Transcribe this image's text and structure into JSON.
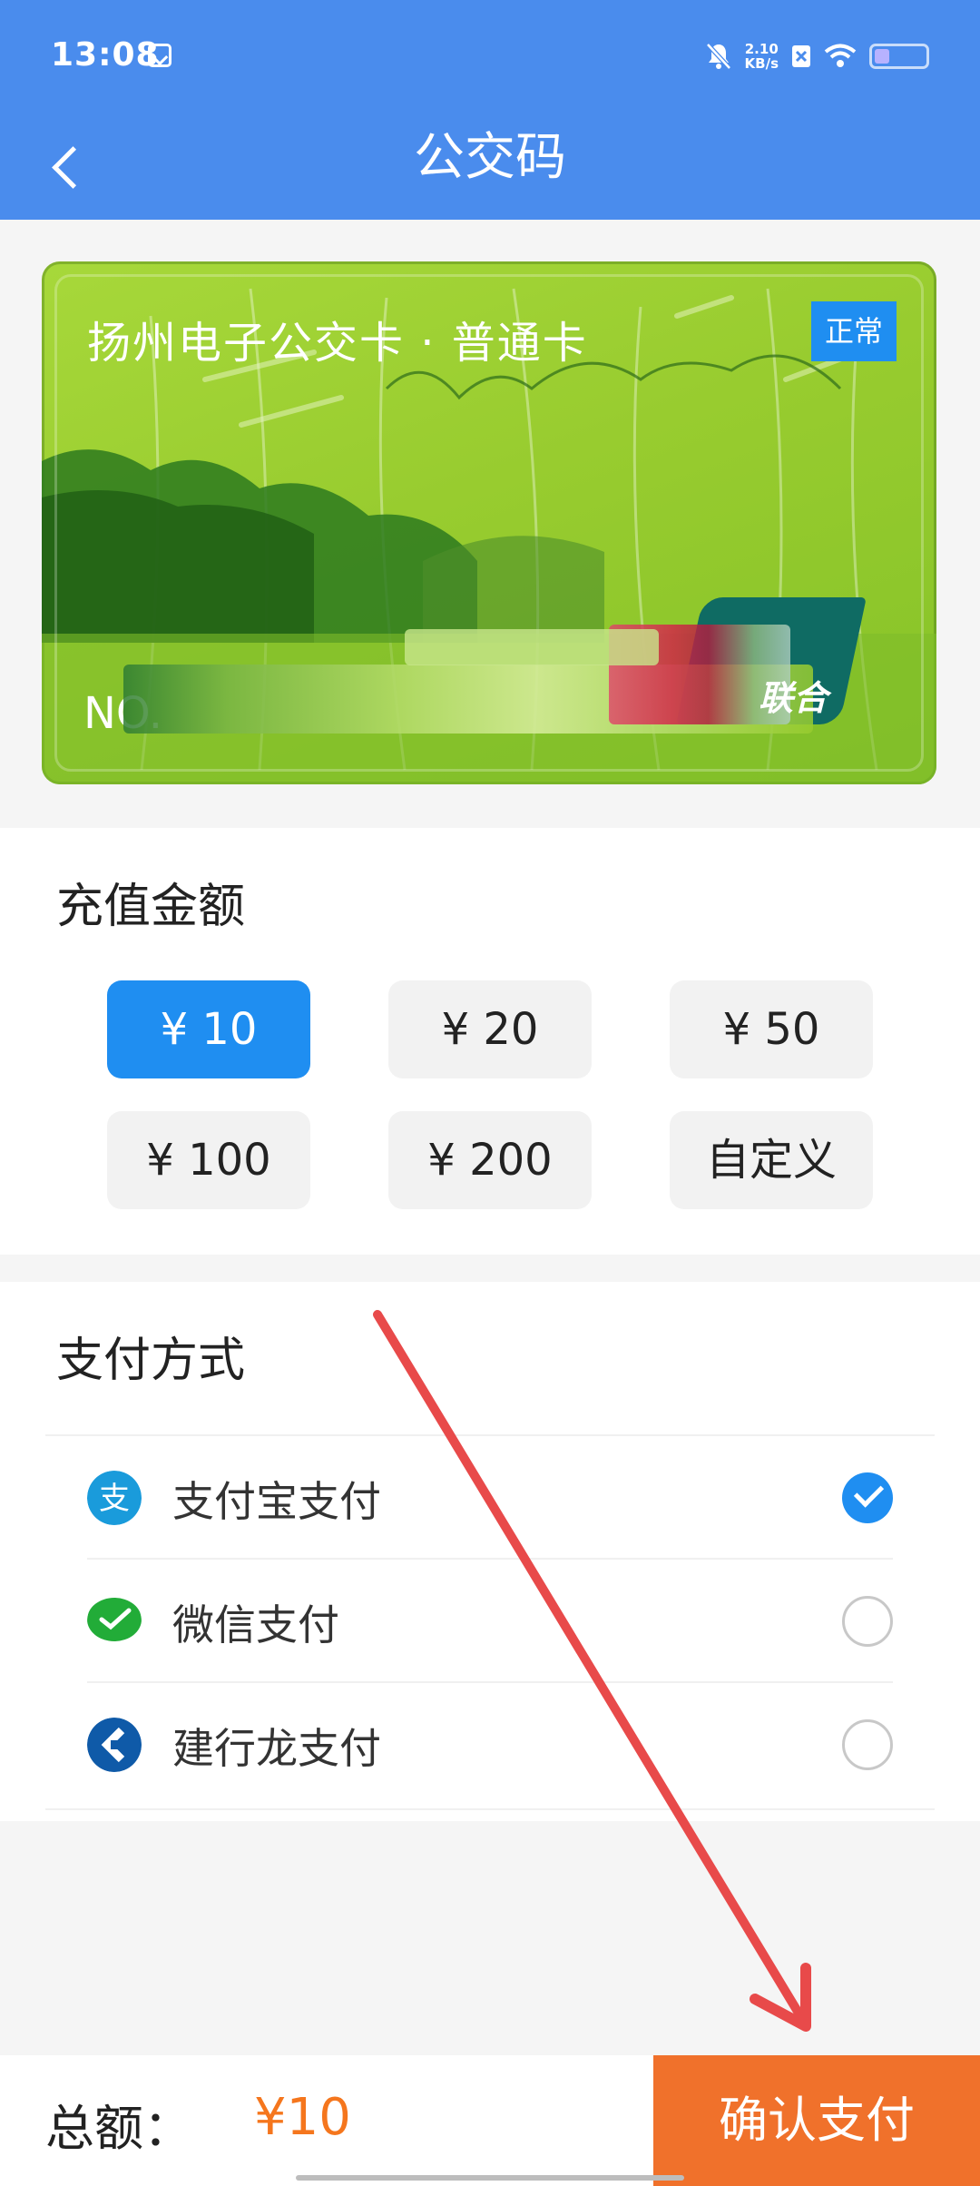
{
  "status_bar": {
    "time": "13:08",
    "net_speed_value": "2.10",
    "net_speed_unit": "KB/s"
  },
  "nav": {
    "title": "公交码"
  },
  "card": {
    "title": "扬州电子公交卡 · 普通卡",
    "status": "正常",
    "number_prefix": "NO."
  },
  "recharge": {
    "title": "充值金额",
    "options": [
      "¥ 10",
      "¥ 20",
      "¥ 50",
      "¥ 100",
      "¥ 200",
      "自定义"
    ],
    "selected_index": 0
  },
  "payment": {
    "title": "支付方式",
    "methods": [
      {
        "label": "支付宝支付",
        "icon": "alipay-icon",
        "checked": true
      },
      {
        "label": "微信支付",
        "icon": "wechat-pay-icon",
        "checked": false
      },
      {
        "label": "建行龙支付",
        "icon": "ccb-icon",
        "checked": false
      }
    ]
  },
  "footer": {
    "total_label": "总额：",
    "total_value": "¥10",
    "confirm_label": "确认支付"
  },
  "colors": {
    "header": "#4a8ced",
    "accent": "#1f8ef1",
    "confirm": "#f0712b",
    "price": "#f5761d",
    "annotation_arrow": "#e84a4a"
  }
}
